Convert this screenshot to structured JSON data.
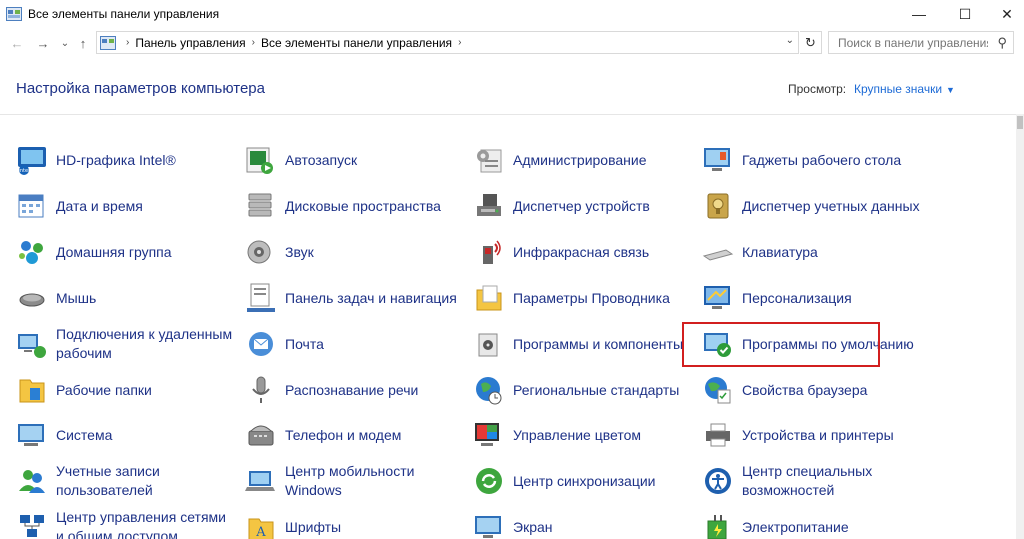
{
  "window": {
    "title": "Все элементы панели управления",
    "minimize": "—",
    "maximize": "☐",
    "close": "✕"
  },
  "nav": {
    "back": "←",
    "forward": "→",
    "recent": "⌄",
    "up": "↑",
    "breadcrumb": [
      "Панель управления",
      "Все элементы панели управления"
    ],
    "search_placeholder": "Поиск в панели управления"
  },
  "header": {
    "title": "Настройка параметров компьютера",
    "view_label": "Просмотр:",
    "view_value": "Крупные значки"
  },
  "items": [
    {
      "label": "HD-графика Intel®",
      "icon": "intel-graphics-icon"
    },
    {
      "label": "Автозапуск",
      "icon": "autoplay-icon"
    },
    {
      "label": "Администрирование",
      "icon": "admin-tools-icon"
    },
    {
      "label": "Гаджеты рабочего стола",
      "icon": "desktop-gadgets-icon"
    },
    {
      "label": "Дата и время",
      "icon": "date-time-icon"
    },
    {
      "label": "Дисковые пространства",
      "icon": "storage-spaces-icon"
    },
    {
      "label": "Диспетчер устройств",
      "icon": "device-manager-icon"
    },
    {
      "label": "Диспетчер учетных данных",
      "icon": "credential-manager-icon"
    },
    {
      "label": "Домашняя группа",
      "icon": "homegroup-icon"
    },
    {
      "label": "Звук",
      "icon": "sound-icon"
    },
    {
      "label": "Инфракрасная связь",
      "icon": "infrared-icon"
    },
    {
      "label": "Клавиатура",
      "icon": "keyboard-icon"
    },
    {
      "label": "Мышь",
      "icon": "mouse-icon"
    },
    {
      "label": "Панель задач и навигация",
      "icon": "taskbar-icon"
    },
    {
      "label": "Параметры Проводника",
      "icon": "explorer-options-icon"
    },
    {
      "label": "Персонализация",
      "icon": "personalization-icon"
    },
    {
      "label": "Подключения к удаленным рабочим",
      "icon": "remote-desktop-icon"
    },
    {
      "label": "Почта",
      "icon": "mail-icon"
    },
    {
      "label": "Программы и компоненты",
      "icon": "programs-features-icon"
    },
    {
      "label": "Программы по умолчанию",
      "icon": "default-programs-icon"
    },
    {
      "label": "Рабочие папки",
      "icon": "work-folders-icon"
    },
    {
      "label": "Распознавание речи",
      "icon": "speech-recognition-icon"
    },
    {
      "label": "Региональные стандарты",
      "icon": "region-icon"
    },
    {
      "label": "Свойства браузера",
      "icon": "internet-options-icon"
    },
    {
      "label": "Система",
      "icon": "system-icon"
    },
    {
      "label": "Телефон и модем",
      "icon": "phone-modem-icon"
    },
    {
      "label": "Управление цветом",
      "icon": "color-management-icon"
    },
    {
      "label": "Устройства и принтеры",
      "icon": "devices-printers-icon"
    },
    {
      "label": "Учетные записи пользователей",
      "icon": "user-accounts-icon"
    },
    {
      "label": "Центр мобильности Windows",
      "icon": "mobility-center-icon"
    },
    {
      "label": "Центр синхронизации",
      "icon": "sync-center-icon"
    },
    {
      "label": "Центр специальных возможностей",
      "icon": "ease-of-access-icon"
    },
    {
      "label": "Центр управления сетями и общим доступом",
      "icon": "network-center-icon"
    },
    {
      "label": "Шрифты",
      "icon": "fonts-icon"
    },
    {
      "label": "Экран",
      "icon": "display-icon"
    },
    {
      "label": "Электропитание",
      "icon": "power-options-icon"
    }
  ],
  "colors": {
    "link": "#1e3287",
    "accent": "#1e6bd6",
    "highlight": "#d21f1f"
  }
}
